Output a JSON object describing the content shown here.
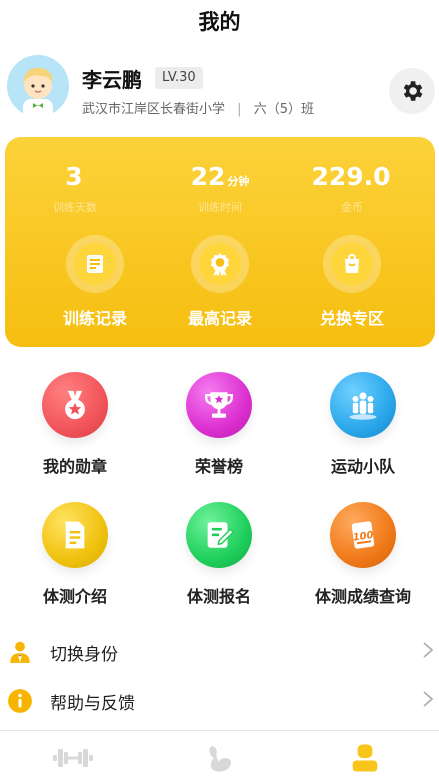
{
  "header": {
    "title": "我的"
  },
  "profile": {
    "name": "李云鹏",
    "level": "LV.30",
    "school": "武汉市江岸区长春街小学",
    "separator": "|",
    "class": "六（5）班"
  },
  "stats": [
    {
      "value": "3",
      "unit": "",
      "label": "训练天数"
    },
    {
      "value": "22",
      "unit": "分钟",
      "label": "训练时间"
    },
    {
      "value": "229.0",
      "unit": "",
      "label": "金币"
    }
  ],
  "card_actions": [
    {
      "label": "训练记录",
      "icon": "list-icon"
    },
    {
      "label": "最高记录",
      "icon": "medal-badge-icon"
    },
    {
      "label": "兑换专区",
      "icon": "shopping-bag-icon"
    }
  ],
  "grid": [
    {
      "label": "我的勋章",
      "icon": "medal-icon",
      "color": "#f2545b"
    },
    {
      "label": "荣誉榜",
      "icon": "trophy-icon",
      "color": "#dc2fd0"
    },
    {
      "label": "运动小队",
      "icon": "team-icon",
      "color": "#2aa7ea"
    },
    {
      "label": "体测介绍",
      "icon": "document-icon",
      "color": "#f0c20f"
    },
    {
      "label": "体测报名",
      "icon": "edit-form-icon",
      "color": "#1fcf5c"
    },
    {
      "label": "体测成绩查询",
      "icon": "score-100-icon",
      "color": "#f07a19"
    }
  ],
  "menu": [
    {
      "label": "切换身份",
      "icon": "switch-identity-icon"
    },
    {
      "label": "帮助与反馈",
      "icon": "info-icon"
    }
  ],
  "tabs": [
    {
      "name": "training",
      "icon": "dumbbell-icon",
      "active": false
    },
    {
      "name": "exercise",
      "icon": "arm-muscle-icon",
      "active": false
    },
    {
      "name": "mine",
      "icon": "person-icon",
      "active": true
    }
  ],
  "colors": {
    "accent": "#f8c51a",
    "tab_inactive": "#d8d8d8"
  }
}
